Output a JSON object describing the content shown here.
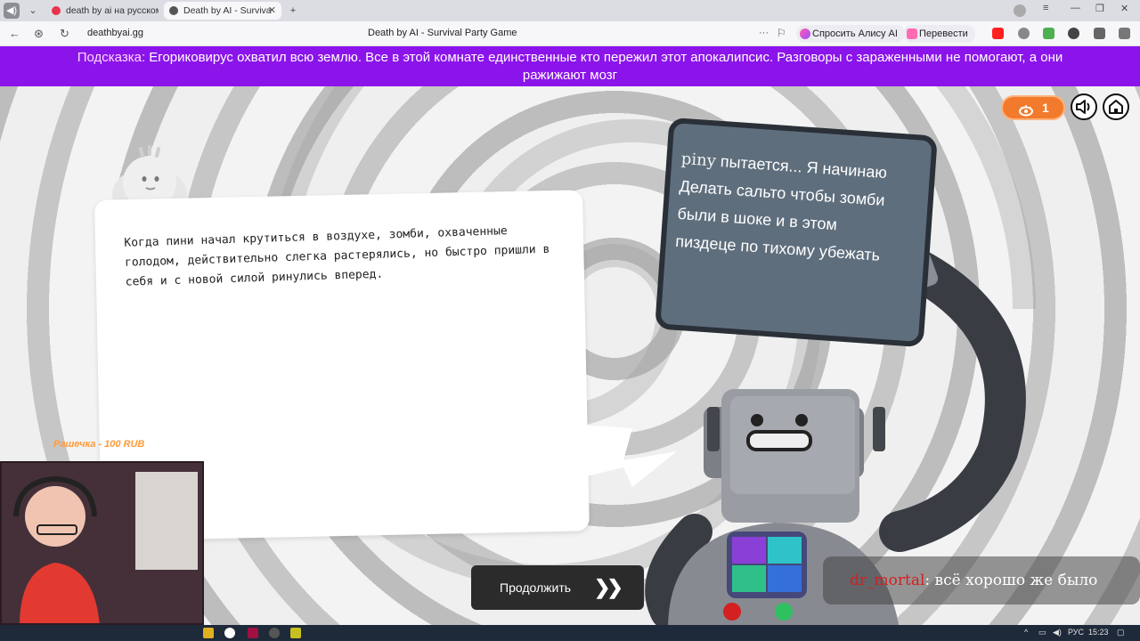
{
  "browser": {
    "tabs": [
      {
        "label": "death by ai на русском —",
        "active": false
      },
      {
        "label": "Death by AI - Surviva",
        "active": true
      }
    ],
    "url": "deathbyai.gg",
    "page_title": "Death by AI - Survival Party Game",
    "toolbar": {
      "ask_alice": "Спросить Алису AI",
      "translate": "Перевести"
    }
  },
  "hint": {
    "label": "Подсказка:",
    "text": "Егориковирус охватил всю землю. Все в этой комнате единственные кто пережил этот апокалипсис. Разговоры с зараженными не помогают, а они ражижают мозг"
  },
  "game": {
    "viewer_count": "1",
    "story_text": "Когда пини начал крутиться в воздухе, зомби, охваченные голодом, действительно слегка растерялись, но быстро пришли в себя и с новой силой ринулись вперед.",
    "screen": {
      "username": "piny",
      "text": "пытается... Я начинаю Делать сальто чтобы зомби были в шоке и в этом пиздеце по тихому убежать"
    },
    "continue_label": "Продолжить",
    "continue_icon": "double-chevron-right"
  },
  "stream": {
    "donation": "Рашечка - 100 RUB",
    "chat_user": "dr_mortal",
    "chat_separator": ":",
    "chat_message": "всё хорошо же было"
  },
  "taskbar": {
    "lang": "РУС",
    "time": "15:23"
  },
  "colors": {
    "hint_bar": "#8b14ea",
    "accent_orange": "#f27a2c",
    "robot_screen": "#5f6e7d"
  }
}
